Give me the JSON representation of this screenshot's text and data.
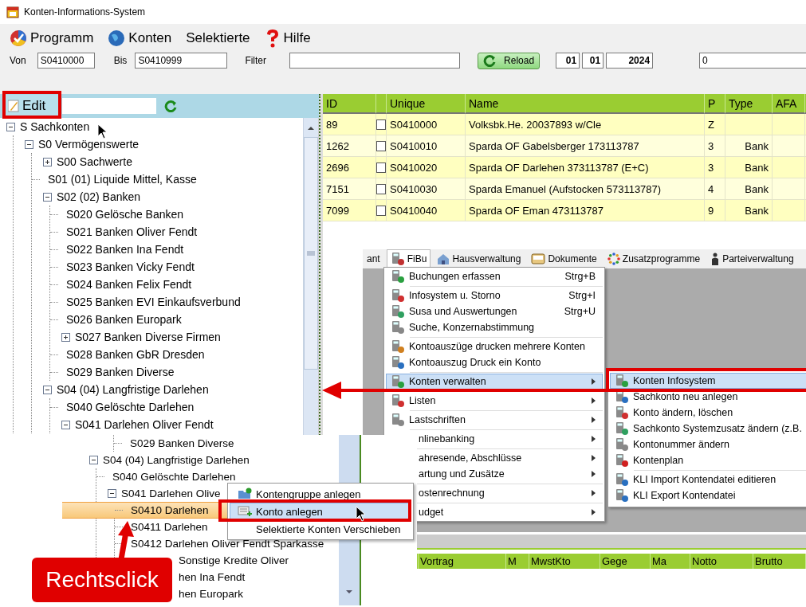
{
  "window": {
    "title": "Konten-Informations-System"
  },
  "menu": [
    {
      "label": "Programm"
    },
    {
      "label": "Konten"
    },
    {
      "label": "Selektierte"
    },
    {
      "label": "Hilfe"
    }
  ],
  "filters": {
    "from": {
      "label": "Von",
      "value": "S0410000"
    },
    "to": {
      "label": "Bis",
      "value": "S0410999"
    },
    "filter": {
      "label": "Filter"
    }
  },
  "reload_button": "Reload",
  "date": {
    "day": "01",
    "month": "01",
    "year": "2024"
  },
  "amount_field": "0",
  "left_panel": {
    "edit_button": "Edit",
    "tree": [
      {
        "label": "S Sachkonten",
        "expanded": true,
        "children": [
          {
            "label": "S0 Vermögenswerte",
            "expanded": true,
            "children": [
              {
                "label": "S00 Sachwerte",
                "expanded": false
              },
              {
                "label": "S01  (01) Liquide Mittel, Kasse"
              },
              {
                "label": "S02  (02) Banken",
                "expanded": true,
                "children": [
                  {
                    "label": "S020 Gelösche Banken"
                  },
                  {
                    "label": "S021 Banken Oliver Fendt"
                  },
                  {
                    "label": "S022 Banken Ina Fendt"
                  },
                  {
                    "label": "S023 Banken Vicky Fendt"
                  },
                  {
                    "label": "S024 Banken Felix Fendt"
                  },
                  {
                    "label": "S025 Banken EVI Einkaufsverbund"
                  },
                  {
                    "label": "S026 Banken Europark"
                  },
                  {
                    "label": "S027 Banken Diverse Firmen",
                    "expanded": false
                  },
                  {
                    "label": "S028 Banken GbR Dresden"
                  },
                  {
                    "label": "S029 Banken Diverse"
                  }
                ]
              },
              {
                "label": "S04  (04) Langfristige Darlehen",
                "expanded": true,
                "children": [
                  {
                    "label": "S040 Gelöschte Darlehen"
                  },
                  {
                    "label": "S041 Darlehen Oliver Fendt",
                    "expanded": true
                  }
                ]
              }
            ]
          }
        ]
      }
    ]
  },
  "table": {
    "columns": [
      "ID",
      "Unique",
      "Name",
      "P",
      "Type",
      "AFA"
    ],
    "rows": [
      {
        "id": "89",
        "checked": false,
        "unique": "S0410000",
        "name": "Volksbk.He. 20037893 w/Cle",
        "p": "Z"
      },
      {
        "id": "1262",
        "checked": false,
        "unique": "S0410010",
        "name": "Sparda OF Gabelsberger 173113787",
        "p": "3",
        "type": "Bank"
      },
      {
        "id": "2696",
        "checked": false,
        "unique": "S0410020",
        "name": "Sparda OF Darlehen 373113787 (E+C)",
        "p": "3",
        "type": "Bank"
      },
      {
        "id": "7151",
        "checked": false,
        "unique": "S0410030",
        "name": "Sparda Emanuel (Aufstocken 573113787)",
        "p": "4",
        "type": "Bank"
      },
      {
        "id": "7099",
        "checked": false,
        "unique": "S0410040",
        "name": "Sparda OF Eman 473113787",
        "p": "9",
        "type": "Bank"
      }
    ]
  },
  "bottom_grid": {
    "columns": [
      "Vortrag",
      "M",
      "MwstKto",
      "Gege",
      "Ma",
      "Notto",
      "Brutto"
    ]
  },
  "menu_inset": {
    "menubar": [
      {
        "label": "ant",
        "selected": false
      },
      {
        "label": "FiBu",
        "selected": true
      },
      {
        "label": "Hausverwaltung",
        "selected": false
      },
      {
        "label": "Dokumente",
        "selected": false
      },
      {
        "label": "Zusatzprogramme",
        "selected": false
      },
      {
        "label": "Parteiverwaltung",
        "selected": false
      }
    ],
    "items": [
      {
        "kind": "item",
        "label": "Buchungen erfassen",
        "shortcut": "Strg+B",
        "selected": false
      },
      {
        "kind": "separator"
      },
      {
        "kind": "item",
        "label": "Infosystem u. Storno",
        "shortcut": "Strg+I",
        "selected": false
      },
      {
        "kind": "item",
        "label": "Susa und Auswertungen",
        "shortcut": "Strg+U",
        "selected": false
      },
      {
        "kind": "item",
        "label": "Suche, Konzernabstimmung",
        "selected": false
      },
      {
        "kind": "separator"
      },
      {
        "kind": "item",
        "label": "Kontoauszüge drucken mehrere Konten",
        "selected": false
      },
      {
        "kind": "item",
        "label": "Kontoauszug Druck ein Konto",
        "selected": false
      },
      {
        "kind": "separator"
      },
      {
        "kind": "item",
        "label": "Konten verwalten",
        "submenu": true,
        "selected": true
      },
      {
        "kind": "separator"
      },
      {
        "kind": "item",
        "label": "Listen",
        "submenu": true,
        "selected": false
      },
      {
        "kind": "separator"
      },
      {
        "kind": "item",
        "label": "Lastschriften",
        "submenu": true,
        "selected": false
      },
      {
        "kind": "separator"
      },
      {
        "kind": "item",
        "label": "nlinebanking",
        "submenu": true,
        "selected": false,
        "cut": true
      },
      {
        "kind": "separator"
      },
      {
        "kind": "item",
        "label": "ahresende, Abschlüsse",
        "submenu": true,
        "selected": false,
        "cut": true
      },
      {
        "kind": "item",
        "label": "artung und Zusätze",
        "submenu": true,
        "selected": false,
        "cut": true
      },
      {
        "kind": "separator"
      },
      {
        "kind": "item",
        "label": "ostenrechnung",
        "submenu": true,
        "selected": false,
        "cut": true
      },
      {
        "kind": "separator"
      },
      {
        "kind": "item",
        "label": "udget",
        "submenu": true,
        "selected": false,
        "cut": true
      }
    ],
    "submenu": [
      {
        "kind": "item",
        "label": "Konten Infosystem",
        "selected": true
      },
      {
        "kind": "item",
        "label": "Sachkonto neu anlegen",
        "selected": false
      },
      {
        "kind": "item",
        "label": "Konto ändern, löschen",
        "selected": false
      },
      {
        "kind": "item",
        "label": "Sachkonto Systemzusatz ändern (z.B.",
        "selected": false
      },
      {
        "kind": "item",
        "label": "Kontonummer ändern",
        "selected": false
      },
      {
        "kind": "item",
        "label": "Kontenplan",
        "selected": false
      },
      {
        "kind": "separator"
      },
      {
        "kind": "item",
        "label": "KLI Import Kontendatei editieren",
        "selected": false
      },
      {
        "kind": "item",
        "label": "KLI Export Kontendatei",
        "selected": false
      }
    ]
  },
  "tree_inset": [
    {
      "children": [
        {
          "label": "S029 Banken Diverse",
          "selected": false
        }
      ]
    },
    {
      "label": "S04  (04) Langfristige Darlehen",
      "expanded": true,
      "selected": false,
      "children": [
        {
          "label": "S040 Gelöschte Darlehen",
          "selected": false,
          "covered": false
        },
        {
          "label": "S041 Darlehen Olive",
          "expanded": true,
          "selected": false,
          "covered": false,
          "children": [
            {
              "label": "S0410 Darlehen",
              "selected": true,
              "covered": false
            },
            {
              "label": "S0411 Darlehen",
              "selected": false,
              "covered": false
            },
            {
              "label": "S0412 Darlehen Oliver Fendt Sparkasse",
              "selected": false,
              "covered": false
            },
            {
              "label": "Sonstige Kredite Oliver",
              "selected": false,
              "covered": true
            }
          ]
        },
        {
          "label": "hen Ina Fendt",
          "selected": false,
          "covered": true
        },
        {
          "label": "hen Europark",
          "selected": false,
          "covered": true
        }
      ]
    }
  ],
  "context_menu": [
    {
      "label": "Kontengruppe anlegen",
      "selected": false
    },
    {
      "label": "Konto anlegen",
      "selected": true
    },
    {
      "label": "Selektierte Konten Verschieben",
      "selected": false
    }
  ],
  "callout": {
    "text": "Rechtsclick"
  }
}
